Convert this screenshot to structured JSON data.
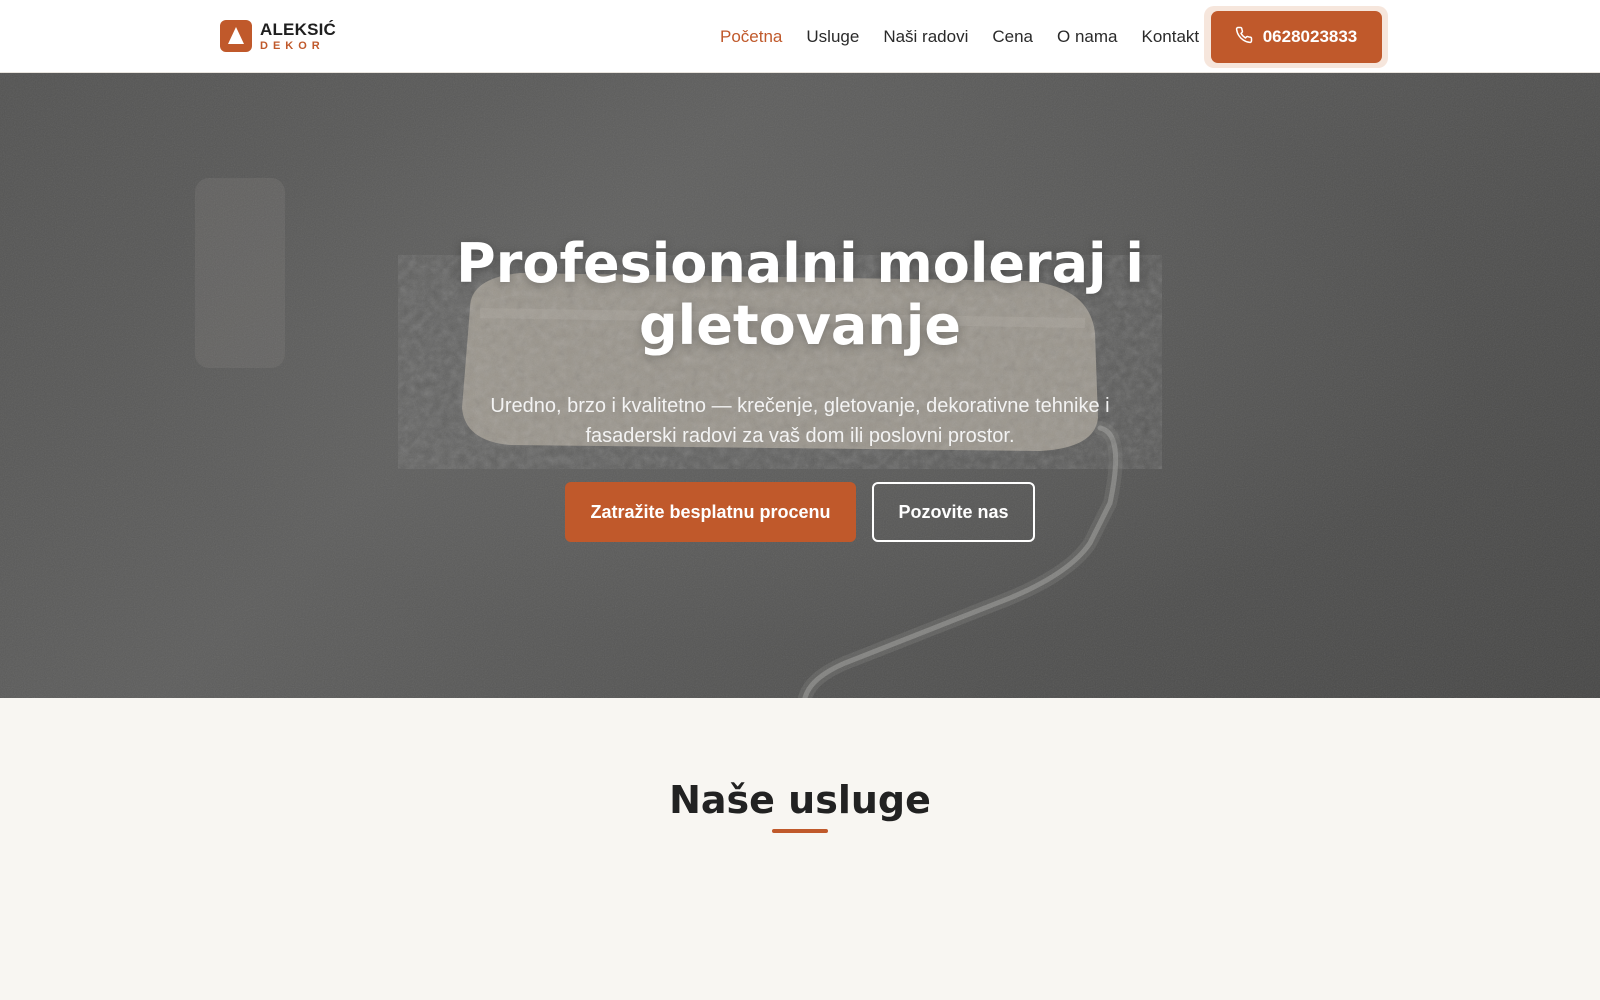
{
  "brand": {
    "name": "ALEKSIĆ",
    "sub": "DEKOR",
    "accent": "#c0592b"
  },
  "nav": {
    "items": [
      {
        "label": "Početna",
        "active": true
      },
      {
        "label": "Usluge",
        "active": false
      },
      {
        "label": "Naši radovi",
        "active": false
      },
      {
        "label": "Cena",
        "active": false
      },
      {
        "label": "O nama",
        "active": false
      },
      {
        "label": "Kontakt",
        "active": false
      }
    ],
    "phone": "0628023833",
    "phone_icon": "phone-icon"
  },
  "hero": {
    "title": "Profesionalni moleraj i gletovanje",
    "subtitle": "Uredno, brzo i kvalitetno — krečenje, gletovanje, dekorativne tehnike i fasaderski radovi za vaš dom ili poslovni prostor.",
    "primary_cta": "Zatražite besplatnu procenu",
    "secondary_cta": "Pozovite nas"
  },
  "services": {
    "title": "Naše usluge"
  }
}
